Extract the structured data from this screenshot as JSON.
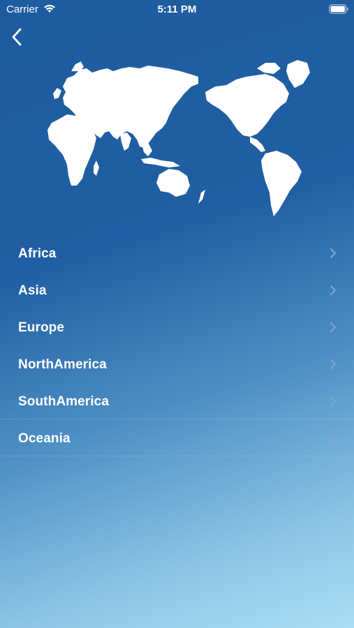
{
  "status_bar": {
    "carrier": "Carrier",
    "time": "5:11 PM",
    "icons": [
      "wifi-icon",
      "battery-icon"
    ]
  },
  "nav": {
    "back_icon": "chevron-left-icon"
  },
  "map": {
    "icon": "world-map"
  },
  "continents": [
    {
      "label": "Africa"
    },
    {
      "label": "Asia"
    },
    {
      "label": "Europe"
    },
    {
      "label": "NorthAmerica"
    },
    {
      "label": "SouthAmerica"
    },
    {
      "label": "Oceania"
    }
  ],
  "colors": {
    "background_top": "#1e5c9f",
    "background_bottom": "#a9def3",
    "text": "#ffffff",
    "chevron": "#7fa8cf"
  }
}
